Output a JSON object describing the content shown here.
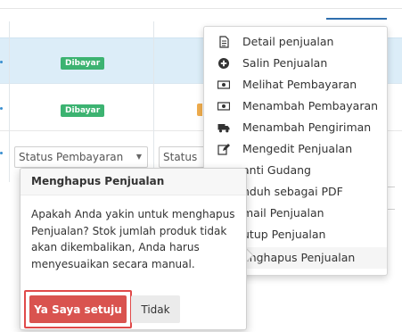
{
  "table": {
    "badges": [
      "Dibayar",
      "Dibayar"
    ],
    "filters": [
      "Status Pembayaran",
      "Status"
    ]
  },
  "menu": {
    "items": [
      {
        "label": "Detail penjualan",
        "icon": "document-icon"
      },
      {
        "label": "Salin Penjualan",
        "icon": "plus-circle-icon"
      },
      {
        "label": "Melihat Pembayaran",
        "icon": "money-icon"
      },
      {
        "label": "Menambah Pembayaran",
        "icon": "money-icon"
      },
      {
        "label": "Menambah Pengiriman",
        "icon": "truck-icon"
      },
      {
        "label": "Mengedit Penjualan",
        "icon": "edit-icon"
      },
      {
        "label": "anti Gudang",
        "icon": ""
      },
      {
        "label": "nduh sebagai PDF",
        "icon": ""
      },
      {
        "label": "mail Penjualan",
        "icon": ""
      },
      {
        "label": "utup Penjualan",
        "icon": ""
      },
      {
        "label": "enghapus Penjualan",
        "icon": ""
      }
    ]
  },
  "popover": {
    "title": "Menghapus Penjualan",
    "body": "Apakah Anda yakin untuk menghapus Penjualan? Stok jumlah produk tidak akan dikembalikan, Anda harus menyesuaikan secara manual.",
    "confirm_label": "Ya Saya setuju",
    "cancel_label": "Tidak"
  },
  "colors": {
    "badge_paid": "#3cb371",
    "confirm": "#d9534f",
    "highlight_outline": "#e04a4a",
    "selected_row": "#dcedf8"
  }
}
